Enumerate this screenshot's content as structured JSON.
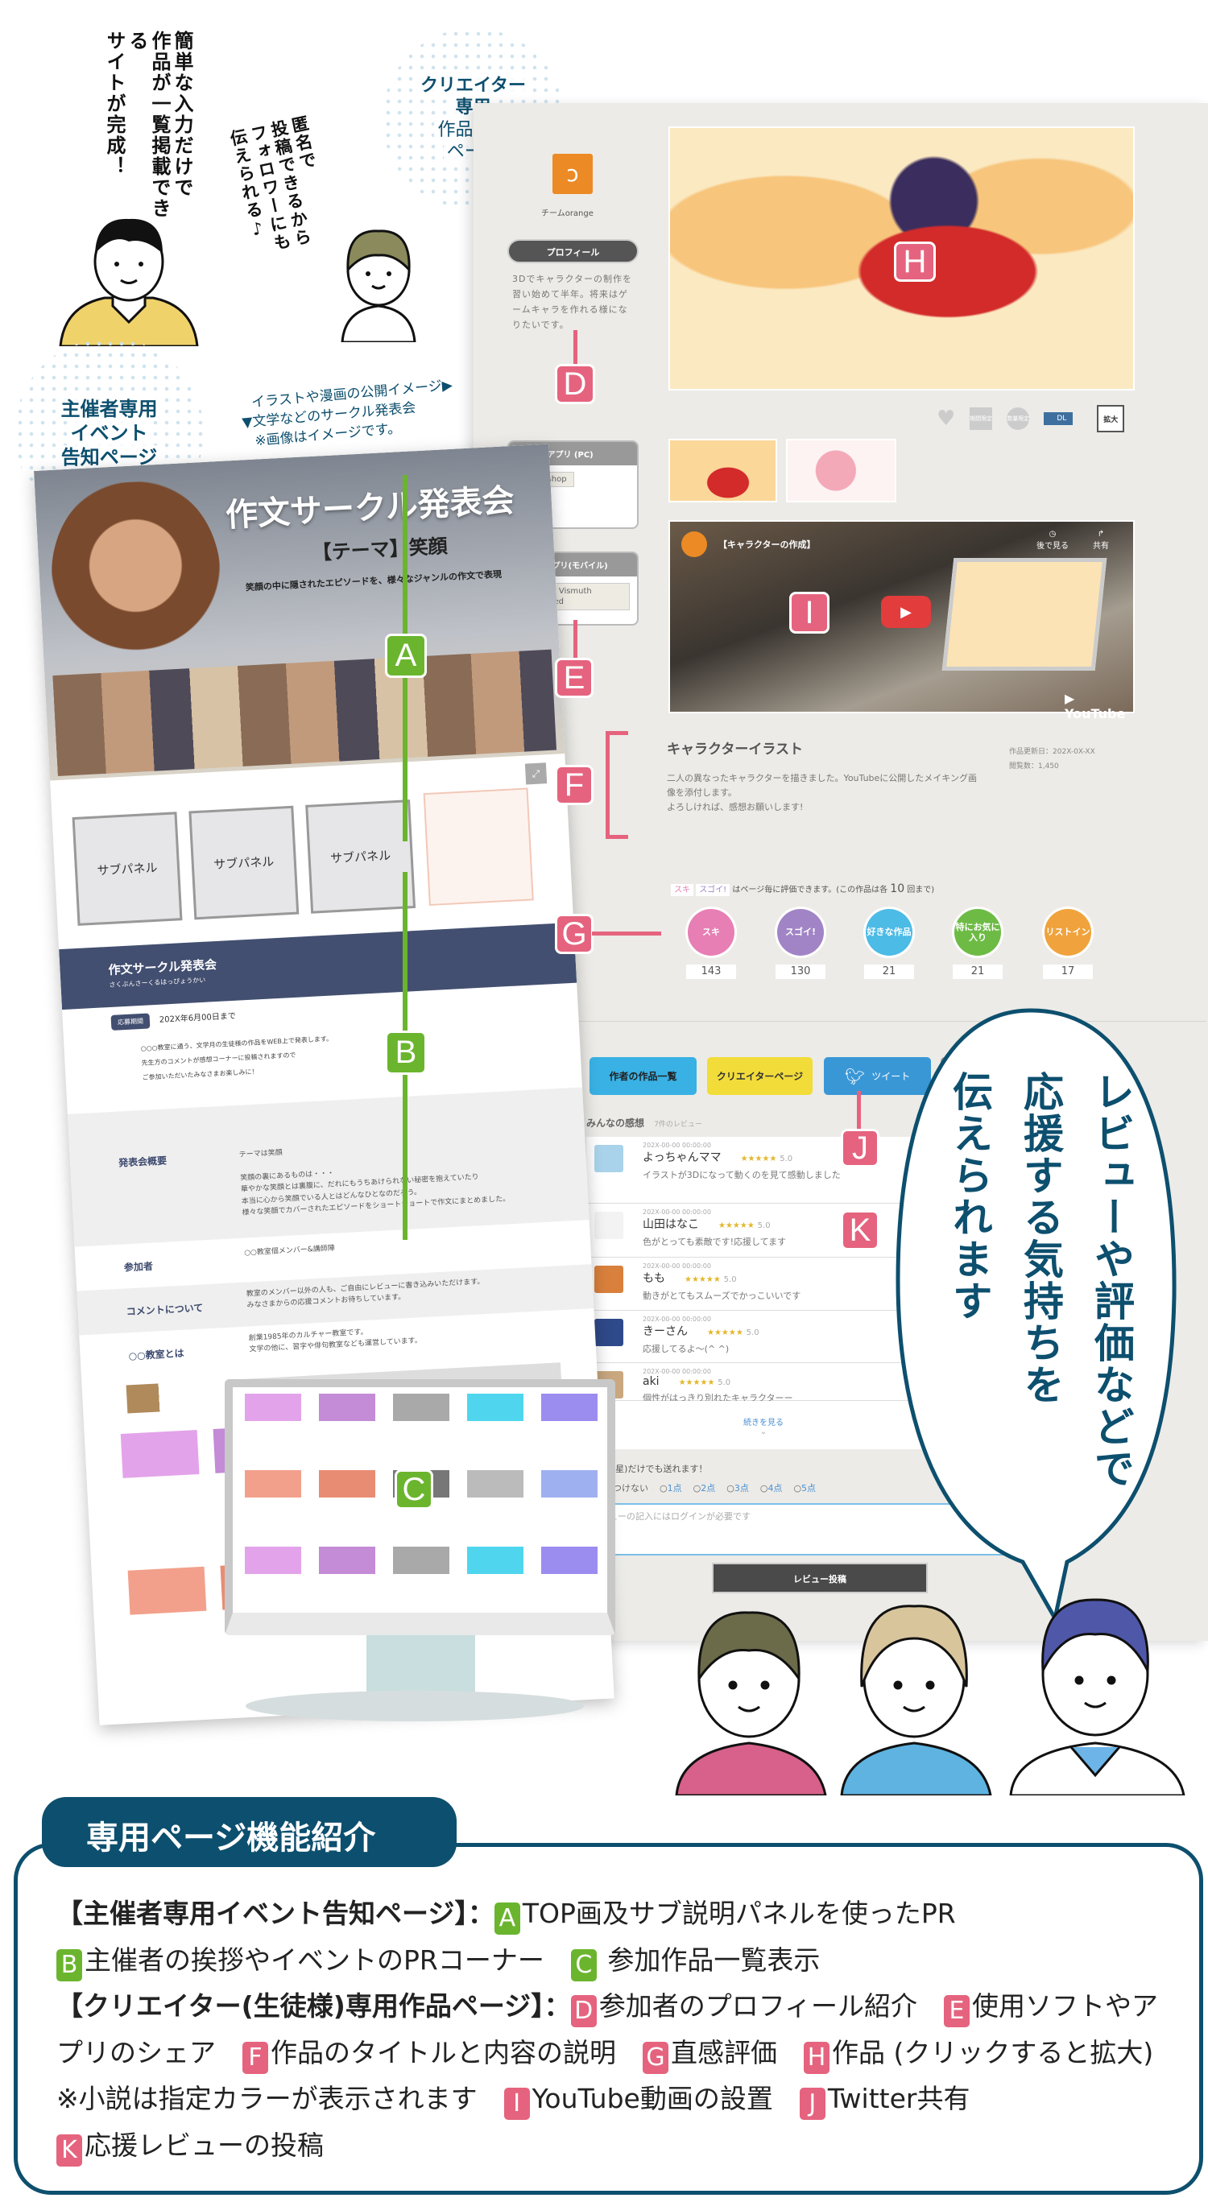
{
  "intro": {
    "organizer_speech": [
      "簡単な入力だけで",
      "作品が一覧掲載できる",
      "サイトが完成！"
    ],
    "creator_speech": [
      "匿名で",
      "投稿できるから",
      "フォロワーにも",
      "伝えられる♪"
    ],
    "organizer_burst": [
      "主催者専用",
      "イベント",
      "告知ページ"
    ],
    "creator_burst": [
      "クリエイター",
      "専用",
      "作品公開",
      "ページ"
    ],
    "caption": [
      "イラストや漫画の公開イメージ▶",
      "▼文学などのサークル発表会",
      "※画像はイメージです。"
    ]
  },
  "event_page": {
    "hero_title": "作文サークル発表会",
    "hero_theme": "【テーマ】笑顔",
    "hero_sub": "笑顔の中に隠されたエピソードを、様々なジャンルの作文で表現",
    "subpanels": [
      "サブパネル",
      "サブパネル",
      "サブパネル"
    ],
    "header_title": "作文サークル発表会",
    "header_ruby": "さくぶんさーくるはっぴょうかい",
    "period_label": "応募期間",
    "period_value": "202X年6月00日まで",
    "intro": [
      "○○○教室に通う、文学月の生徒様の作品をWEB上で発表します。",
      "先生方のコメントが感想コーナーに投稿されますので",
      "ご参加いただいたみなさまお楽しみに！"
    ],
    "rows": [
      {
        "label": "発表会概要",
        "value": "テーマは笑顔\n\n笑顔の裏にあるものは・・・\n華やかな笑顔とは裏腹に、だれにもうちあけられない秘密を抱えていたり\n本当に心から笑顔でいる人とはどんなひとなのだろう。\n様々な笑顔でカバーされたエピソードをショートショートで作文にまとめました。"
      },
      {
        "label": "参加者",
        "value": "○○教室個メンバー&講師陣"
      },
      {
        "label": "コメントについて",
        "value": "教室のメンバー以外の人も、ご自由にレビューに書き込みいただけます。\nみなさまからの応援コメントお待ちしています。"
      },
      {
        "label": "○○教室とは",
        "value": "創業1985年のカルチャー教室です。\n文学の他に、習字や俳句教室なども運営しています。"
      }
    ]
  },
  "creator_page": {
    "team_name": "チームorange",
    "profile_button": "プロフィール",
    "profile_text": "3Dでキャラクターの制作を習い始めて半年。将来はゲームキャラを作れる様になりたいです。",
    "app_pc": {
      "title": "使用アプリ (PC)",
      "apps": [
        "Photoshop"
      ]
    },
    "app_mobile": {
      "title": "使用アプリ(モバイル)",
      "apps": [
        "VPocket Vismuth",
        "Snapseed"
      ]
    },
    "image_tools": {
      "dl": "DL",
      "expand": "拡大",
      "limited_period": "期間限定",
      "limited_qty": "数量限定"
    },
    "video": {
      "title": "【キャラクターの作成】",
      "watch_later": "後で見る",
      "share": "共有",
      "brand": "YouTube"
    },
    "work_title": "キャラクターイラスト",
    "work_description": [
      "二人の異なったキャラクターを描きました。YouTubeに公開したメイキング画像を添付します。",
      "よろしければ、感想お願いします!"
    ],
    "updated_label": "作品更新日：",
    "updated_value": "202X-0X-XX",
    "views_label": "閲覧数：",
    "views_value": "1,450",
    "rating_notice": {
      "tag1": "スキ",
      "tag2": "スゴイ!",
      "text": "はページ毎に評価できます。(この作品は各",
      "limit": "10",
      "suffix": "回まで)"
    },
    "ratings": [
      {
        "label": "スキ",
        "count": "143",
        "color": "#e77fb4"
      },
      {
        "label": "スゴイ!",
        "count": "130",
        "color": "#a184c6"
      },
      {
        "label": "好きな作品",
        "count": "21",
        "color": "#4cbbe6"
      },
      {
        "label": "特にお気に入り",
        "count": "21",
        "color": "#6dbb45"
      },
      {
        "label": "リストイン",
        "count": "17",
        "color": "#f0a33c"
      }
    ],
    "buttons": {
      "works": "作者の作品一覧",
      "creator": "クリエイターページ",
      "tweet": "ツイート"
    },
    "reviews_title": "みんなの感想",
    "reviews_count": "7件のレビュー",
    "reviews": [
      {
        "date": "202X-00-00 00:00:00",
        "name": "よっちゃんママ",
        "stars": "★★★★★",
        "score": "5.0",
        "text": "イラストが3Dになって動くのを見て感動しました"
      },
      {
        "date": "202X-00-00 00:00:00",
        "name": "山田はなこ",
        "stars": "★★★★★",
        "score": "5.0",
        "text": "色がとっても素敵です!応援してます"
      },
      {
        "date": "202X-00-00 00:00:00",
        "name": "もも",
        "stars": "★★★★★",
        "score": "5.0",
        "text": "動きがとてもスムーズでかっこいいです"
      },
      {
        "date": "202X-00-00 00:00:00",
        "name": "きーさん",
        "stars": "★★★★★",
        "score": "5.0",
        "text": "応援してるよ〜(^ ^)"
      },
      {
        "date": "202X-00-00 00:00:00",
        "name": "aki",
        "stars": "★★★★★",
        "score": "5.0",
        "text": "個性がはっきり別れたキャラクターー"
      }
    ],
    "see_more": "続きを見る",
    "rating_prompt": "点数(★星)だけでも送れます！",
    "score_options": [
      "点数はつけない",
      "1点",
      "2点",
      "3点",
      "4点",
      "5点"
    ],
    "review_placeholder": "レビューの記入にはログインが必要です",
    "post_button": "レビュー投稿"
  },
  "markers": {
    "A": "A",
    "B": "B",
    "C": "C",
    "D": "D",
    "E": "E",
    "F": "F",
    "G": "G",
    "H": "H",
    "I": "I",
    "J": "J",
    "K": "K"
  },
  "speech_bubble": [
    "レビューや評価などで",
    "応援する気持ちを",
    "伝えられます"
  ],
  "features": {
    "title": "専用ページ機能紹介",
    "organizer_heading": "【主催者専用イベント告知ページ】：",
    "A": "TOP画及サブ説明パネルを使ったPR",
    "B": "主催者の挨拶やイベントのPRコーナー",
    "C": "参加作品一覧表示",
    "creator_heading": "【クリエイター(生徒様)専用作品ページ】：",
    "D": "参加者のプロフィール紹介",
    "E": "使用ソフトやアプリのシェア",
    "F": "作品のタイトルと内容の説明",
    "G": "直感評価",
    "H": "作品 (クリックすると拡大) ※小説は指定カラーが表示されます",
    "I": "YouTube動画の設置",
    "J": "Twitter共有",
    "K": "応援レビューの投稿"
  },
  "colors": {
    "brand_navy": "#0d4f6e",
    "marker_pink": "#e5637e",
    "marker_green": "#6bb52e",
    "panel_bg": "#ecebe7",
    "event_navy": "#434f70"
  }
}
